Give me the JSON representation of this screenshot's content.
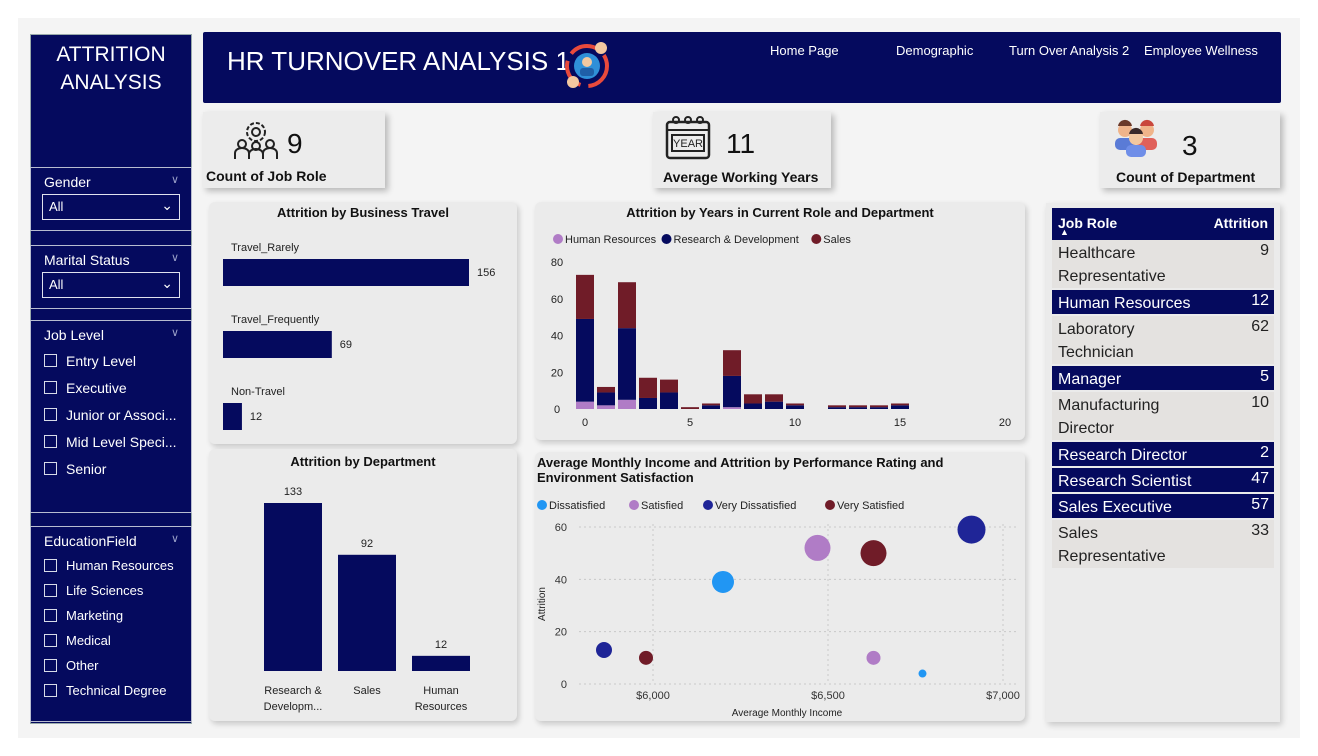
{
  "sidebar": {
    "title_line1": "ATTRITION",
    "title_line2": "ANALYSIS",
    "gender": {
      "label": "Gender",
      "value": "All"
    },
    "marital": {
      "label": "Marital Status",
      "value": "All"
    },
    "job_level": {
      "label": "Job Level",
      "options": [
        "Entry Level",
        "Executive",
        "Junior or Associ...",
        "Mid Level Speci...",
        "Senior"
      ]
    },
    "education": {
      "label": "EducationField",
      "options": [
        "Human Resources",
        "Life Sciences",
        "Marketing",
        "Medical",
        "Other",
        "Technical Degree"
      ]
    }
  },
  "header": {
    "title": "HR TURNOVER ANALYSIS 1",
    "nav": [
      "Home Page",
      "Demographic",
      "Turn Over Analysis 2",
      "Employee Wellness"
    ]
  },
  "kpis": {
    "job_role": {
      "value": "9",
      "label": "Count of Job Role"
    },
    "working_years": {
      "value": "11",
      "label": "Average Working Years",
      "icon_text": "YEAR"
    },
    "department": {
      "value": "3",
      "label": "Count of Department"
    }
  },
  "colors": {
    "navy": "#050a5e",
    "maroon": "#701c28",
    "lavender": "#b07cc6",
    "blue_light": "#2196f3",
    "navy_bubble": "#1f2597"
  },
  "table": {
    "col_role": "Job Role",
    "col_attrition": "Attrition",
    "rows": [
      {
        "name_l1": "Healthcare",
        "name_l2": "Representative",
        "value": "9"
      },
      {
        "name_l1": "Human Resources",
        "name_l2": "",
        "value": "12"
      },
      {
        "name_l1": "Laboratory",
        "name_l2": "Technician",
        "value": "62"
      },
      {
        "name_l1": "Manager",
        "name_l2": "",
        "value": "5"
      },
      {
        "name_l1": "Manufacturing",
        "name_l2": "Director",
        "value": "10"
      },
      {
        "name_l1": "Research Director",
        "name_l2": "",
        "value": "2"
      },
      {
        "name_l1": "Research Scientist",
        "name_l2": "",
        "value": "47"
      },
      {
        "name_l1": "Sales Executive",
        "name_l2": "",
        "value": "57"
      },
      {
        "name_l1": "Sales",
        "name_l2": "Representative",
        "value": "33"
      }
    ]
  },
  "chart_data": [
    {
      "type": "bar",
      "orientation": "horizontal",
      "title": "Attrition by Business Travel",
      "categories": [
        "Travel_Rarely",
        "Travel_Frequently",
        "Non-Travel"
      ],
      "values": [
        156,
        69,
        12
      ]
    },
    {
      "type": "bar",
      "title": "Attrition by Department",
      "categories": [
        "Research &",
        "Sales",
        "Human"
      ],
      "categories_line2": [
        "Developm...",
        "",
        "Resources"
      ],
      "values": [
        133,
        92,
        12
      ]
    },
    {
      "type": "bar",
      "stacked": true,
      "title": "Attrition by Years in Current Role and Department",
      "x": [
        0,
        1,
        2,
        3,
        4,
        5,
        6,
        7,
        8,
        9,
        10,
        11,
        12,
        13,
        14,
        15
      ],
      "series": [
        {
          "name": "Human Resources",
          "values": [
            4,
            2,
            5,
            0,
            0,
            0,
            0,
            1,
            0,
            0,
            0,
            0,
            0,
            0,
            0,
            0
          ]
        },
        {
          "name": "Research & Development",
          "values": [
            45,
            7,
            39,
            6,
            9,
            0,
            2,
            17,
            3,
            4,
            2,
            0,
            1,
            1,
            1,
            2
          ]
        },
        {
          "name": "Sales",
          "values": [
            24,
            3,
            25,
            11,
            7,
            1,
            1,
            14,
            5,
            4,
            1,
            0,
            1,
            1,
            1,
            1
          ]
        }
      ],
      "xticks": [
        "0",
        "5",
        "10",
        "15",
        "20"
      ],
      "yticks": [
        "0",
        "20",
        "40",
        "60",
        "80"
      ],
      "ylim": [
        0,
        80
      ],
      "xlim": [
        -0.5,
        20
      ]
    },
    {
      "type": "scatter",
      "title_line1": "Average Monthly Income and Attrition by Performance Rating and",
      "title_line2": "Environment Satisfaction",
      "xlabel": "Average Monthly Income",
      "ylabel": "Attrition",
      "xticks": [
        "$6,000",
        "$6,500",
        "$7,000"
      ],
      "yticks": [
        "0",
        "20",
        "40",
        "60"
      ],
      "xlim": [
        5660,
        7060
      ],
      "ylim": [
        0,
        60
      ],
      "series": [
        {
          "name": "Dissatisfied",
          "color": "#2196f3",
          "points": [
            [
              6200,
              39,
              11
            ],
            [
              6770,
              4,
              4
            ]
          ]
        },
        {
          "name": "Satisfied",
          "color": "#b07cc6",
          "points": [
            [
              6470,
              52,
              13
            ],
            [
              6630,
              10,
              7
            ]
          ]
        },
        {
          "name": "Very Dissatisfied",
          "color": "#1f2597",
          "points": [
            [
              6910,
              59,
              14
            ],
            [
              5860,
              13,
              8
            ]
          ]
        },
        {
          "name": "Very Satisfied",
          "color": "#701c28",
          "points": [
            [
              6630,
              50,
              13
            ],
            [
              5980,
              10,
              7
            ]
          ]
        }
      ]
    }
  ]
}
